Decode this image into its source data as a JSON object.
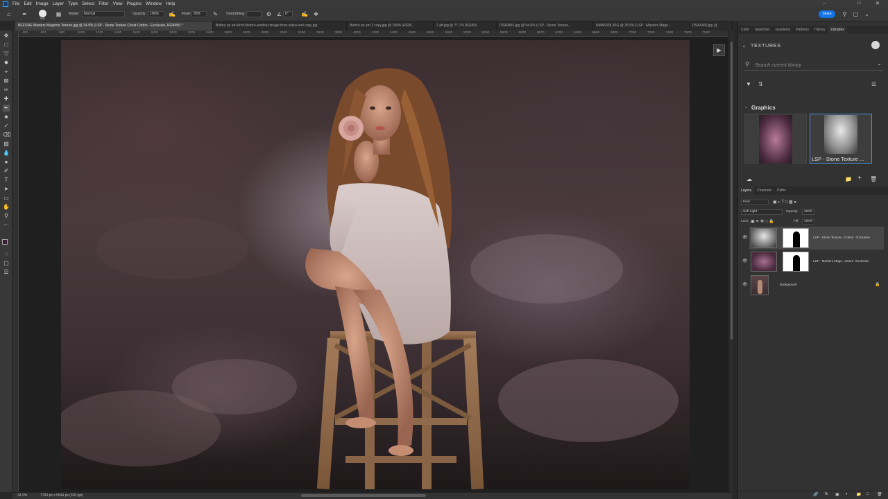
{
  "menubar": {
    "items": [
      "File",
      "Edit",
      "Image",
      "Layer",
      "Type",
      "Select",
      "Filter",
      "View",
      "Plugins",
      "Window",
      "Help"
    ]
  },
  "options": {
    "brush_size": "500",
    "mode_label": "Mode:",
    "mode_value": "Normal",
    "opacity_label": "Opacity:",
    "opacity_value": "100%",
    "flow_label": "Flow:",
    "flow_value": "83%",
    "smoothing_label": "Smoothing:",
    "angle_value": "0°",
    "share_label": "Share"
  },
  "tabs": [
    {
      "label": "BEFORE Masters Magenta Texture.jpg @ 34.9% (LSP - Stone Texture Cloud Cotton - Exclusive, RGB/8#) *"
    },
    {
      "label": "Before ps atn Arch-Before-anothe-rimage-from-video-reel copy.jpg"
    },
    {
      "label": "Before ps atn 2 copy.jpg @ 100% (RGB/..."
    },
    {
      "label": "2 aft.jpg @ 77.7% (RGB/8..."
    },
    {
      "label": "DSA9481.jpg @ 54.6% (LSP - Stone Texture..."
    },
    {
      "label": "NMA6308.JPG @ 28.9% (LSP - Masters Mage..."
    },
    {
      "label": "DSA4360.jpg @"
    }
  ],
  "ruler_top": [
    "400",
    "600",
    "800",
    "1000",
    "1200",
    "1400",
    "1600",
    "1800",
    "2000",
    "2200",
    "2400",
    "2600",
    "2800",
    "3000",
    "3200",
    "3400",
    "3600",
    "3800",
    "4000",
    "4200",
    "4400",
    "4600",
    "4800",
    "5000",
    "5200",
    "5400",
    "5600",
    "5800",
    "6000",
    "6200",
    "6400",
    "6600",
    "6800",
    "7000",
    "7200",
    "7400",
    "7600",
    "7800"
  ],
  "status": {
    "zoom": "34.9%",
    "doc_info": "7790 px x 5644 px (300 ppi)"
  },
  "panels": {
    "top_tabs": [
      "Color",
      "Swatches",
      "Gradients",
      "Patterns",
      "History",
      "Libraries"
    ],
    "active_top_tab": "Libraries",
    "library_title": "TEXTURES",
    "search_placeholder": "Search current library",
    "graphics_title": "Graphics",
    "thumbs": [
      {
        "caption": ""
      },
      {
        "caption": "LSP - Stone Texture ..."
      }
    ],
    "layer_tabs": [
      "Layers",
      "Channels",
      "Paths"
    ],
    "kind_label": "Kind",
    "blend_mode": "Soft Light",
    "opacity_label": "Opacity:",
    "opacity_value": "100%",
    "lock_label": "Lock:",
    "fill_label": "Fill:",
    "fill_value": "100%",
    "layers": [
      {
        "name": "LSP - Stone Texture...Cotton - Exclusive"
      },
      {
        "name": "LSP - Masters Mage...exture -Exclusive"
      },
      {
        "name": "Background"
      }
    ]
  },
  "colors": {
    "accent": "#1473e6",
    "selection": "#4b8fd9"
  }
}
